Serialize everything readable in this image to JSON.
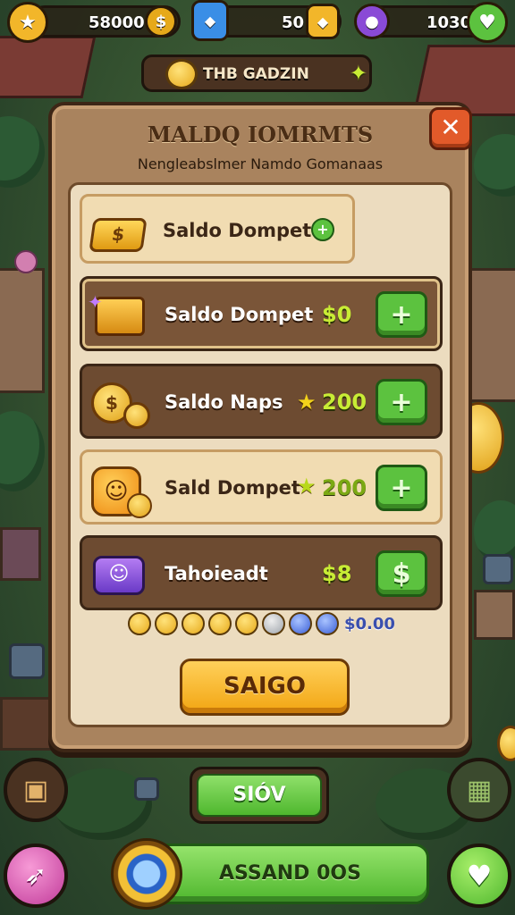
{
  "resources": {
    "coins": "58000",
    "tokens": "50",
    "gems": "1030"
  },
  "header": {
    "location_label": "THB GADZIN"
  },
  "dialog": {
    "title": "MALDQ IOMRMTS",
    "subtitle": "Nengleabslmer Namdo Gomanaas",
    "close_label": "✕"
  },
  "shop_items": [
    {
      "label": "Saldo Dompet",
      "price": "",
      "style": "light",
      "icon": "gold-bar-icon"
    },
    {
      "label": "Saldo Dompet",
      "price": "$0",
      "style": "dark",
      "icon": "treasure-chest-icon"
    },
    {
      "label": "Saldo Naps",
      "price": "200",
      "style": "dark",
      "icon": "coin-pile-icon"
    },
    {
      "label": "Sald Dompet",
      "price": "200",
      "style": "light",
      "icon": "smiley-coin-icon"
    },
    {
      "label": "Tahoieadt",
      "price": "$8",
      "style": "dark2",
      "icon": "robot-wallet-icon"
    }
  ],
  "coin_strip": {
    "total": "$0.00"
  },
  "buttons": {
    "primary": "SAIGO",
    "secondary": "SIÓV",
    "bottom": "ASSAND 0OS"
  },
  "colors": {
    "accent_green": "#5cc23f",
    "accent_orange": "#f2a512",
    "panel": "#a9835e",
    "inner_panel": "#ecdcbf",
    "close_red": "#e25a2a"
  }
}
